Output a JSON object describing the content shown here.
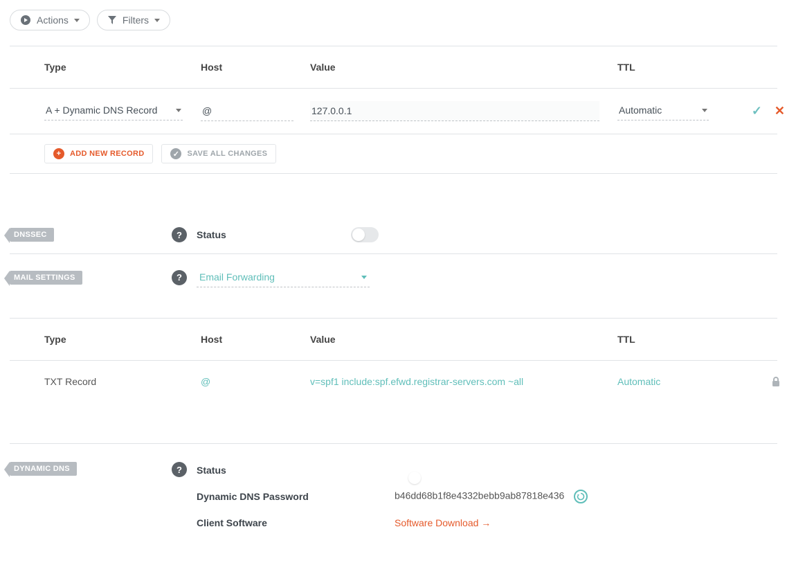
{
  "toolbar": {
    "actions_label": "Actions",
    "filters_label": "Filters"
  },
  "headers": {
    "type": "Type",
    "host": "Host",
    "value": "Value",
    "ttl": "TTL"
  },
  "edit_record": {
    "type": "A + Dynamic DNS Record",
    "host": "@",
    "value": "127.0.0.1",
    "ttl": "Automatic"
  },
  "buttons": {
    "add_new_record": "ADD NEW RECORD",
    "save_all_changes": "SAVE ALL CHANGES"
  },
  "sections": {
    "dnssec": "DNSSEC",
    "mail_settings": "MAIL SETTINGS",
    "dynamic_dns": "DYNAMIC DNS"
  },
  "labels": {
    "status": "Status",
    "dyndns_password": "Dynamic DNS Password",
    "client_software": "Client Software"
  },
  "mail": {
    "forwarding_select": "Email Forwarding",
    "record": {
      "type": "TXT Record",
      "host": "@",
      "value": "v=spf1 include:spf.efwd.registrar-servers.com ~all",
      "ttl": "Automatic"
    }
  },
  "dyndns": {
    "password": "b46dd68b1f8e4332bebb9ab87818e436",
    "download_link": "Software Download →",
    "status_on": true
  },
  "dnssec": {
    "status_on": false
  },
  "icons": {
    "help": "?",
    "plus": "+",
    "tick": "✓",
    "check": "✓",
    "x": "✕"
  }
}
